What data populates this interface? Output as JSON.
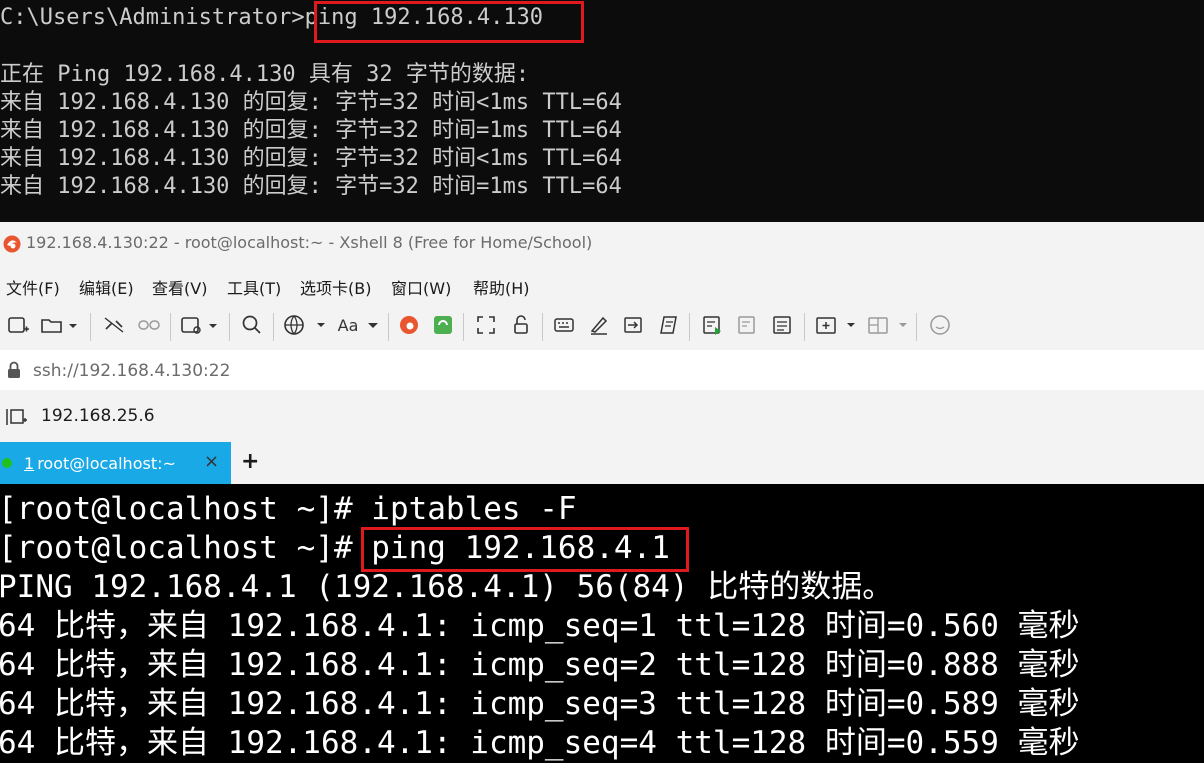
{
  "cmd": {
    "prompt": "C:\\Users\\Administrator>",
    "command": "ping 192.168.4.130",
    "header": "正在 Ping 192.168.4.130 具有 32 字节的数据:",
    "replies": [
      "来自 192.168.4.130 的回复: 字节=32 时间<1ms TTL=64",
      "来自 192.168.4.130 的回复: 字节=32 时间=1ms TTL=64",
      "来自 192.168.4.130 的回复: 字节=32 时间<1ms TTL=64",
      "来自 192.168.4.130 的回复: 字节=32 时间=1ms TTL=64"
    ]
  },
  "xshell": {
    "title": "192.168.4.130:22 - root@localhost:~ - Xshell 8 (Free for Home/School)",
    "menu": [
      "文件(F)",
      "编辑(E)",
      "查看(V)",
      "工具(T)",
      "选项卡(B)",
      "窗口(W)",
      "帮助(H)"
    ],
    "toolbar_font_label": "Aa",
    "address": "ssh://192.168.4.130:22",
    "session": "192.168.25.6",
    "tab": {
      "number": "1",
      "label": "root@localhost:~",
      "close": "×",
      "status_color": "#21c21e"
    },
    "add_tab": "+"
  },
  "terminal": {
    "prompt": "[root@localhost ~]# ",
    "cmd1": "iptables -F",
    "cmd2": "ping 192.168.4.1",
    "ping_header": "PING 192.168.4.1 (192.168.4.1) 56(84) 比特的数据。",
    "replies": [
      "64 比特，来自 192.168.4.1: icmp_seq=1 ttl=128 时间=0.560 毫秒",
      "64 比特，来自 192.168.4.1: icmp_seq=2 ttl=128 时间=0.888 毫秒",
      "64 比特，来自 192.168.4.1: icmp_seq=3 ttl=128 时间=0.589 毫秒",
      "64 比特，来自 192.168.4.1: icmp_seq=4 ttl=128 时间=0.559 毫秒"
    ]
  },
  "colors": {
    "highlight_box": "#e0191e",
    "tab_active": "#19a9e6",
    "cmd_bg": "#0c0c0c"
  }
}
